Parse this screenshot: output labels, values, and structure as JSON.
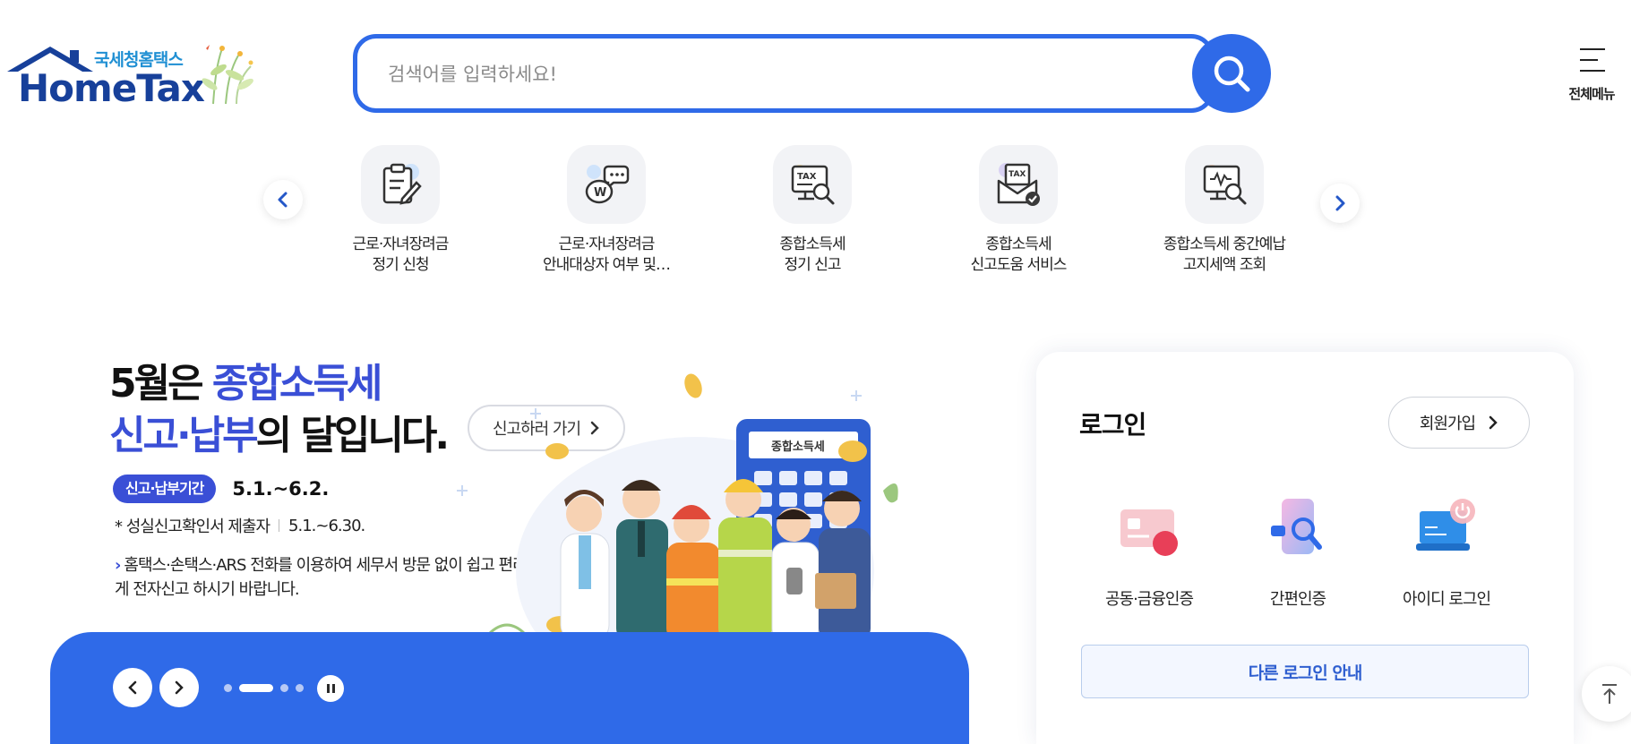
{
  "header": {
    "logo_sub": "국세청홈택스",
    "logo_main": "HomeTax",
    "search_placeholder": "검색어를 입력하세요!",
    "all_menu_label": "전체메뉴"
  },
  "quick_services": [
    {
      "icon": "clipboard-pen-icon",
      "line1": "근로·자녀장려금",
      "line2": "정기 신청"
    },
    {
      "icon": "piggy-bank-chat-icon",
      "line1": "근로·자녀장려금",
      "line2": "안내대상자 여부 및…"
    },
    {
      "icon": "tax-monitor-search-icon",
      "line1": "종합소득세",
      "line2": "정기 신고"
    },
    {
      "icon": "tax-envelope-check-icon",
      "line1": "종합소득세",
      "line2": "신고도움 서비스"
    },
    {
      "icon": "won-monitor-search-icon",
      "line1": "종합소득세 중간예납",
      "line2": "고지세액 조회"
    }
  ],
  "banner": {
    "head_line1_a": "5월은 ",
    "head_line1_b": "종합소득세",
    "head_line2_a": "신고·납부",
    "head_line2_b": "의 달입니다.",
    "cta_label": "신고하러 가기",
    "period_badge": "신고·납부기간",
    "period_value": "5.1.~6.2.",
    "line2_label": "* 성실신고확인서 제출자",
    "line2_value": "5.1.~6.30.",
    "line3_arrow": "›",
    "line3_text": "홈택스·손택스·ARS 전화를 이용하여 세무서 방문 없이 쉽고 편리하게 전자신고 하시기 바랍니다.",
    "calculator_label": "종합소득세",
    "slides_total": 4,
    "slide_active": 2,
    "colors": {
      "accent": "#2f6ae8",
      "headline_blue": "#3a4fd6"
    }
  },
  "login": {
    "title": "로그인",
    "join_label": "회원가입",
    "options": [
      {
        "icon": "certificate-card-icon",
        "label": "공동·금융인증"
      },
      {
        "icon": "phone-search-icon",
        "label": "간편인증"
      },
      {
        "icon": "laptop-power-icon",
        "label": "아이디 로그인"
      }
    ],
    "other_label": "다른 로그인 안내"
  }
}
